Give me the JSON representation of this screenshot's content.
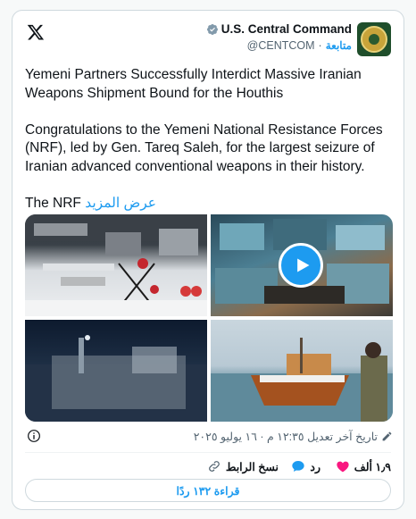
{
  "author": {
    "name": "U.S. Central Command",
    "handle": "@CENTCOM",
    "follow_label": "متابعة",
    "separator": "·"
  },
  "post": {
    "headline": "Yemeni Partners Successfully Interdict Massive Iranian Weapons Shipment Bound for the Houthis",
    "body": "Congratulations to the Yemeni National Resistance  Forces (NRF), led by Gen. Tareq Saleh, for the largest seizure of Iranian advanced conventional weapons in their history.",
    "truncated_text": "The NRF",
    "show_more": "عرض المزيد"
  },
  "media": {
    "tiles": [
      "weapons-display-photo",
      "video-thumbnail",
      "night-boat-photo",
      "dhow-boat-photo"
    ]
  },
  "meta": {
    "timestamp": "تاريخ آخر تعديل ١٢:٣٥ م · ١٦ يوليو ٢٠٢٥"
  },
  "actions": {
    "likes": "١٫٩ ألف",
    "reply": "رد",
    "copy_link": "نسخ الرابط"
  },
  "read_replies": "قراءة ١٣٢ ردًا",
  "colors": {
    "accent": "#1d9bf0",
    "like": "#f91880",
    "muted": "#536471"
  }
}
